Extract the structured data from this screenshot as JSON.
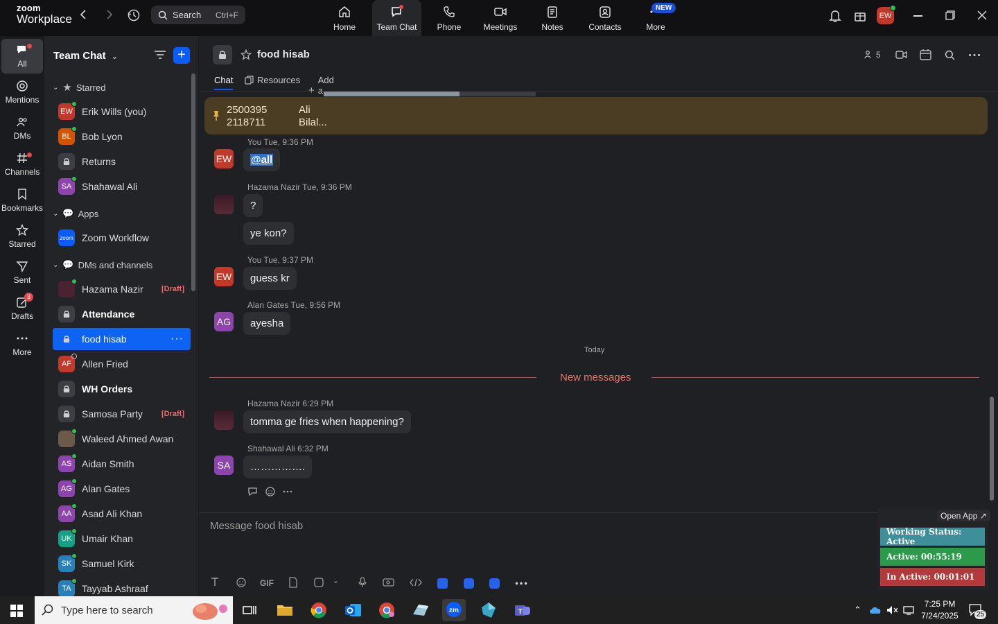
{
  "brand": {
    "line1": "zoom",
    "line2": "Workplace"
  },
  "search": {
    "label": "Search",
    "shortcut": "Ctrl+F"
  },
  "nav_tabs": [
    {
      "label": "Home"
    },
    {
      "label": "Team Chat"
    },
    {
      "label": "Phone"
    },
    {
      "label": "Meetings"
    },
    {
      "label": "Notes"
    },
    {
      "label": "Contacts"
    },
    {
      "label": "More",
      "badge": "NEW"
    }
  ],
  "user_avatar": "EW",
  "rail": [
    {
      "label": "All"
    },
    {
      "label": "Mentions"
    },
    {
      "label": "DMs"
    },
    {
      "label": "Channels"
    },
    {
      "label": "Bookmarks"
    },
    {
      "label": "Starred"
    },
    {
      "label": "Sent"
    },
    {
      "label": "Drafts",
      "badge": "3"
    },
    {
      "label": "More"
    }
  ],
  "sidebar": {
    "title": "Team Chat",
    "sections": [
      {
        "label": "Starred"
      },
      {
        "label": "Apps"
      },
      {
        "label": "DMs and channels"
      }
    ],
    "starred": [
      {
        "name": "Erik Wills (you)",
        "initials": "EW",
        "color": "#c0392b"
      },
      {
        "name": "Bob Lyon",
        "initials": "BL",
        "color": "#d35400"
      },
      {
        "name": "Returns",
        "initials": "",
        "color": "#3d3e43"
      },
      {
        "name": "Shahawal Ali",
        "initials": "SA",
        "color": "#8e44ad"
      }
    ],
    "apps": [
      {
        "name": "Zoom Workflow",
        "initials": "zoom",
        "color": "#0b5cff"
      }
    ],
    "dms": [
      {
        "name": "Hazama Nazir",
        "initials": "",
        "color": "#4a2230",
        "draft": "[Draft]"
      },
      {
        "name": "Attendance",
        "initials": "",
        "color": "#3d3e43"
      },
      {
        "name": "food hisab",
        "initials": "",
        "color": "#0e63f4"
      },
      {
        "name": "Allen Fried",
        "initials": "AF",
        "color": "#c0392b"
      },
      {
        "name": "WH Orders",
        "initials": "",
        "color": "#3d3e43"
      },
      {
        "name": "Samosa Party",
        "initials": "",
        "color": "#3d3e43",
        "draft": "[Draft]"
      },
      {
        "name": "Waleed Ahmed Awan",
        "initials": "",
        "color": "#6b5a4a"
      },
      {
        "name": "Aidan Smith",
        "initials": "AS",
        "color": "#8e44ad"
      },
      {
        "name": "Alan Gates",
        "initials": "AG",
        "color": "#8e44ad"
      },
      {
        "name": "Asad Ali Khan",
        "initials": "AA",
        "color": "#8e44ad"
      },
      {
        "name": "Umair Khan",
        "initials": "UK",
        "color": "#16a085"
      },
      {
        "name": "Samuel Kirk",
        "initials": "SK",
        "color": "#2980b9"
      },
      {
        "name": "Tayyab Ashraaf",
        "initials": "TA",
        "color": "#2980b9"
      }
    ]
  },
  "channel": {
    "title": "food hisab",
    "member_count": "5",
    "tabs": [
      "Chat",
      "Resources",
      "Add a tab"
    ]
  },
  "pinned": {
    "line1_id": "2500395",
    "line1_name": "Ali",
    "line2_id": "2118711",
    "line2_name": "Bilal..."
  },
  "messages": [
    {
      "meta_name": "You",
      "meta_time": "Tue, 9:36 PM",
      "text": "@all",
      "avatar": "EW"
    },
    {
      "meta_name": "Hazama Nazir",
      "meta_time": "Tue, 9:36 PM",
      "text": "?",
      "text2": "ye kon?"
    },
    {
      "meta_name": "You",
      "meta_time": "Tue, 9:37 PM",
      "text": "guess kr",
      "avatar": "EW"
    },
    {
      "meta_name": "Alan Gates",
      "meta_time": "Tue, 9:56 PM",
      "text": "ayesha",
      "avatar": "AG"
    },
    {
      "meta_name": "Hazama Nazir",
      "meta_time": "6:29 PM",
      "text": "tomma ge fries when happening?"
    },
    {
      "meta_name": "Shahawal Ali",
      "meta_time": "6:32 PM",
      "text": "…………….",
      "avatar": "SA"
    }
  ],
  "divider_today": "Today",
  "new_messages": "New messages",
  "composer": {
    "placeholder": "Message food hisab",
    "gif": "GIF"
  },
  "widget": {
    "open_app": "Open App ↗",
    "status": "Working Status: Active",
    "active": "Active: 00:55:19",
    "inactive": "In Active: 00:01:01"
  },
  "taskbar": {
    "search_placeholder": "Type here to search",
    "time": "7:25 PM",
    "date": "7/24/2025",
    "notif_count": "25"
  },
  "colors": {
    "accent": "#0b5cff",
    "active_row": "#0e63f4",
    "pinned_bg": "#4a3d23",
    "new_messages": "#e4756b"
  }
}
